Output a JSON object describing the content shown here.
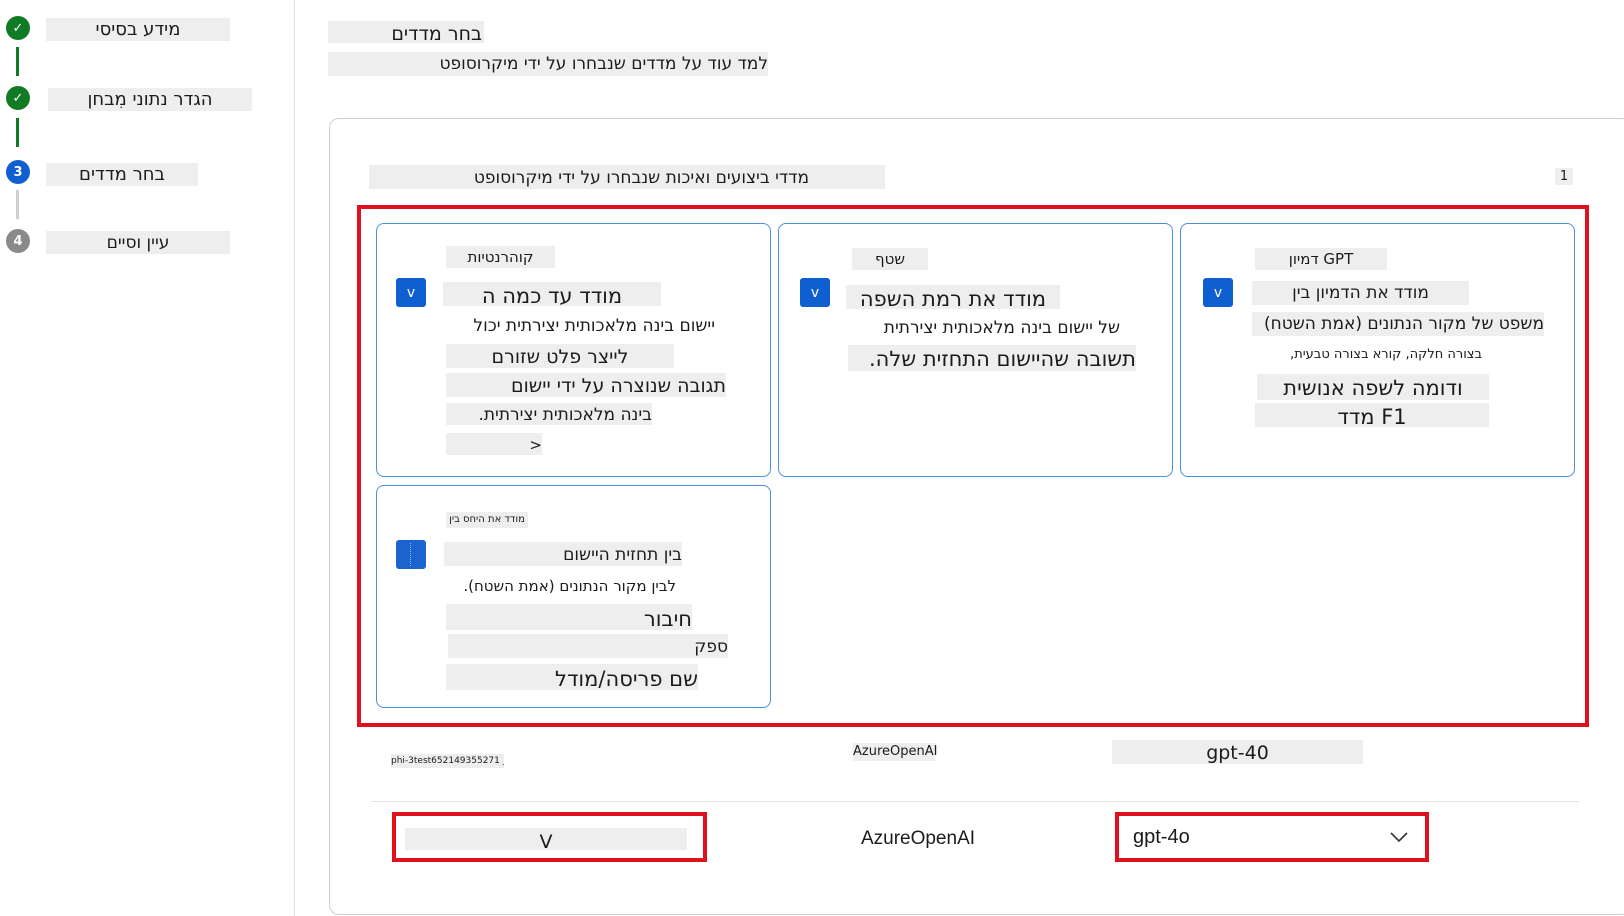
{
  "stepper": {
    "steps": [
      {
        "label": "מידע בסיסי",
        "number": "",
        "status": "completed"
      },
      {
        "label": "הגדר נתוני מִבחן",
        "number": "",
        "status": "completed"
      },
      {
        "label": "בחר מדדים",
        "number": "3",
        "status": "active"
      },
      {
        "label": "עיין וסיים",
        "number": "4",
        "status": "pending"
      }
    ]
  },
  "header": {
    "title": "בחר מדדים",
    "learn_more": "למד עוד על מדדים שנבחרו על ידי מיקרוסופט"
  },
  "section": {
    "title": "מדדי ביצועים ואיכות שנבחרו על ידי מיקרוסופט",
    "count": "1"
  },
  "cards": {
    "gpt_similarity": {
      "title": "דמיון GPT",
      "checkbox": "v",
      "lines": [
        "מודד את הדמיון בין",
        "משפט של מקור הנתונים (אמת השטח)",
        "בצורה חלקה, קורא בצורה טבעית,",
        "ודומה לשפה אנושית",
        "מדד F1"
      ]
    },
    "fluency": {
      "title": "שטף",
      "checkbox": "v",
      "lines": [
        "מודד את רמת השפה",
        "של יישום בינה מלאכותית יצירתית",
        "תשובה שהיישום התחזית שלה."
      ]
    },
    "coherence": {
      "title": "קוהרנטיות",
      "checkbox": "v",
      "lines": [
        "מודד עד כמה ה",
        "יישום בינה מלאכותית יצירתית יכול",
        "לייצר פלט שזורם",
        "תגובה שנוצרה על ידי יישום",
        "בינה מלאכותית יצירתית.",
        ">"
      ]
    },
    "relation": {
      "title": "מודד את היחס בין",
      "checkbox": "",
      "lines": [
        "בין תחזית היישום",
        "לבין מקור הנתונים (אמת השטח).",
        "חיבור",
        "ספק",
        "שם פריסה/מודל"
      ]
    }
  },
  "row_info": {
    "connection": "phi-3test652149355271 _...V",
    "provider": "AzureOpenAI",
    "model": "gpt-40"
  },
  "inputs": {
    "connection_value": "V",
    "provider_value": "AzureOpenAI",
    "model_value": "gpt-4o"
  },
  "colors": {
    "completed": "#117a25",
    "active": "#0f5fd1",
    "pending": "#8a8a8a",
    "highlight": "#e0101c",
    "card_border": "#4a90d9"
  }
}
